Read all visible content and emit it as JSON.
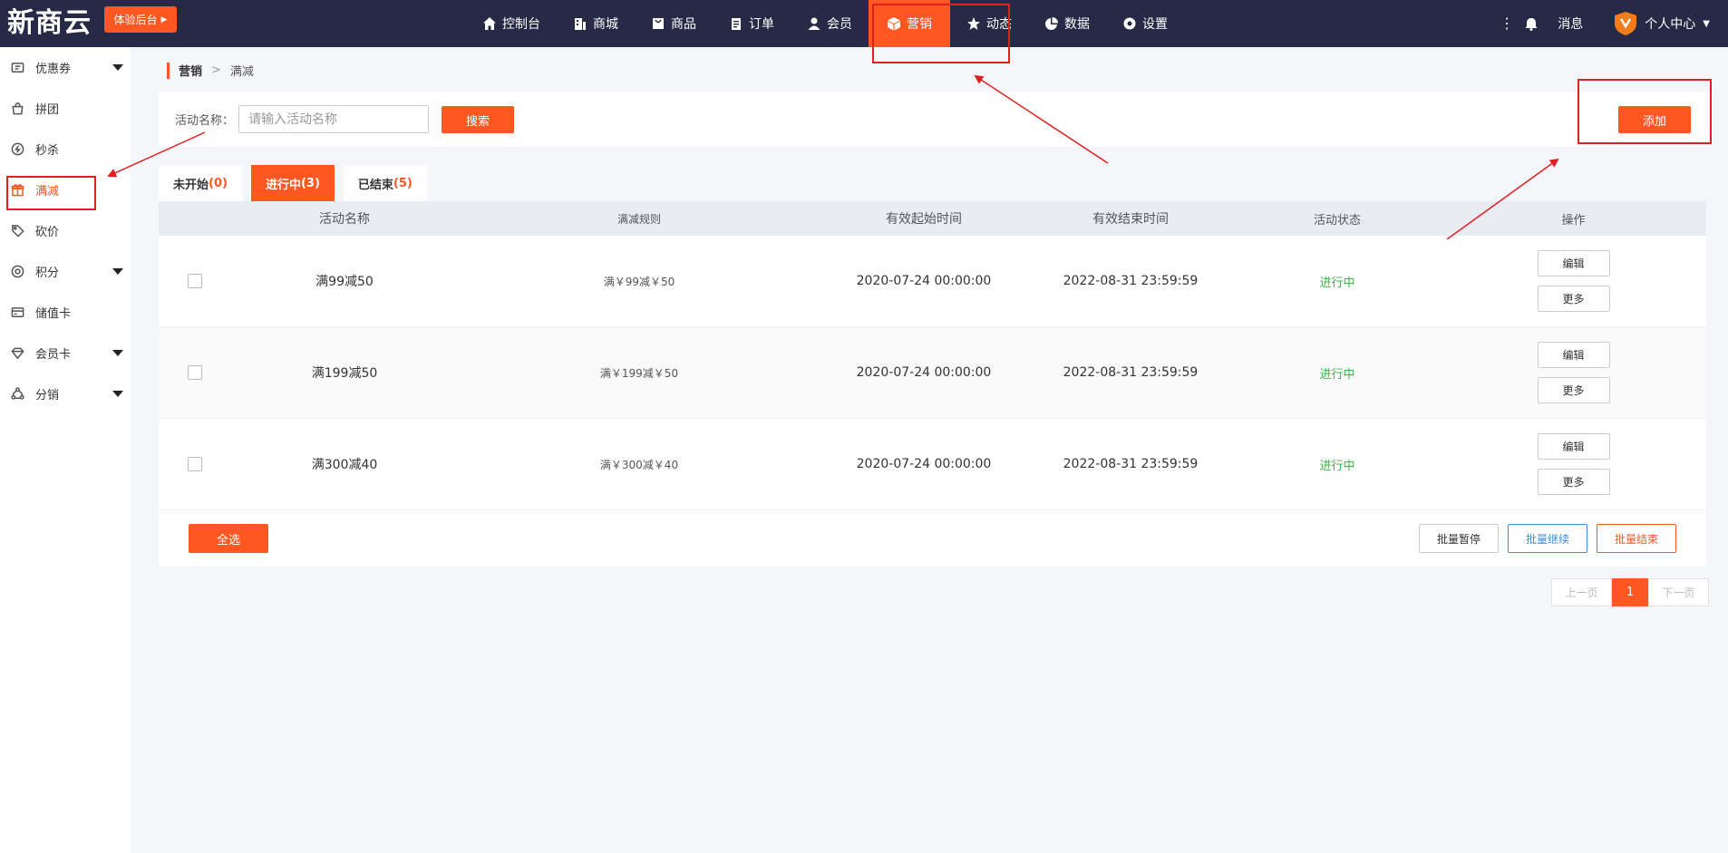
{
  "header": {
    "logo": "新商云",
    "trial_label": "体验后台",
    "nav": [
      {
        "label": "控制台",
        "icon": "home-icon"
      },
      {
        "label": "商城",
        "icon": "building-icon"
      },
      {
        "label": "商品",
        "icon": "bag-icon"
      },
      {
        "label": "订单",
        "icon": "clipboard-icon"
      },
      {
        "label": "会员",
        "icon": "user-icon"
      },
      {
        "label": "营销",
        "icon": "cube-icon",
        "active": true
      },
      {
        "label": "动态",
        "icon": "star-icon"
      },
      {
        "label": "数据",
        "icon": "pie-icon"
      },
      {
        "label": "设置",
        "icon": "gear-icon"
      }
    ],
    "message_label": "消息",
    "user_label": "个人中心"
  },
  "sidebar": {
    "items": [
      {
        "label": "优惠券",
        "icon": "coupon-icon",
        "has_caret": true
      },
      {
        "label": "拼团",
        "icon": "group-bag-icon"
      },
      {
        "label": "秒杀",
        "icon": "flash-icon"
      },
      {
        "label": "满减",
        "icon": "gift-icon",
        "active": true
      },
      {
        "label": "砍价",
        "icon": "tag-icon"
      },
      {
        "label": "积分",
        "icon": "points-icon",
        "has_caret": true
      },
      {
        "label": "储值卡",
        "icon": "card-icon"
      },
      {
        "label": "会员卡",
        "icon": "diamond-icon",
        "has_caret": true
      },
      {
        "label": "分销",
        "icon": "share-icon",
        "has_caret": true
      }
    ]
  },
  "breadcrumb": {
    "parent": "营销",
    "separator": ">",
    "current": "满减"
  },
  "search": {
    "label": "活动名称：",
    "placeholder": "请输入活动名称",
    "value": "",
    "search_label": "搜索",
    "add_label": "添加"
  },
  "tabs": [
    {
      "label": "未开始",
      "count": "(0)"
    },
    {
      "label": "进行中",
      "count": "(3)",
      "active": true
    },
    {
      "label": "已结束",
      "count": "(5)"
    }
  ],
  "table": {
    "headers": {
      "name": "活动名称",
      "rule": "满减规则",
      "start": "有效起始时间",
      "end": "有效结束时间",
      "status": "活动状态",
      "ops": "操作"
    },
    "rows": [
      {
        "name": "满99减50",
        "rule": "满￥99减￥50",
        "start": "2020-07-24 00:00:00",
        "end": "2022-08-31 23:59:59",
        "status": "进行中"
      },
      {
        "name": "满199减50",
        "rule": "满￥199减￥50",
        "start": "2020-07-24 00:00:00",
        "end": "2022-08-31 23:59:59",
        "status": "进行中"
      },
      {
        "name": "满300减40",
        "rule": "满￥300减￥40",
        "start": "2020-07-24 00:00:00",
        "end": "2022-08-31 23:59:59",
        "status": "进行中"
      }
    ],
    "edit_label": "编辑",
    "more_label": "更多",
    "select_all_label": "全选",
    "batch_pause_label": "批量暂停",
    "batch_continue_label": "批量继续",
    "batch_end_label": "批量结束"
  },
  "pagination": {
    "prev": "上一页",
    "current": "1",
    "next": "下一页"
  },
  "colors": {
    "accent": "#ff5722",
    "topbar": "#262a46",
    "status_green": "#3bb54a",
    "annotation_red": "#e02020",
    "batch_continue_blue": "#3d8ee0"
  }
}
